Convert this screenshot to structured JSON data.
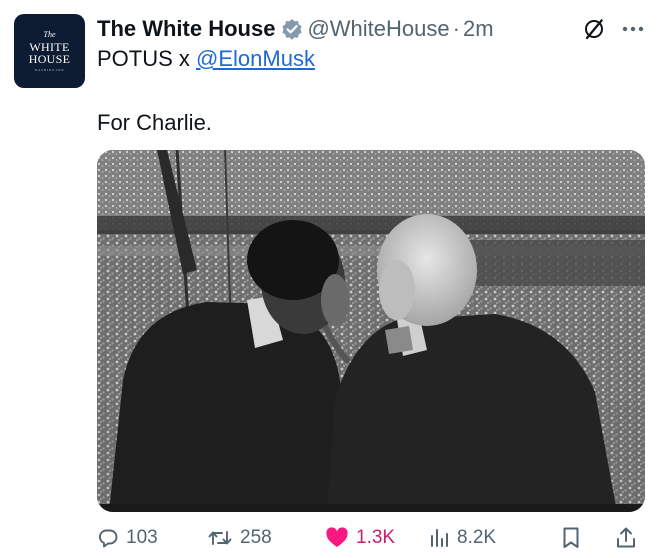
{
  "tweet": {
    "display_name": "The White House",
    "handle": "@WhiteHouse",
    "separator": "·",
    "time": "2m",
    "sub_prefix": "POTUS x",
    "mention": "@ElonMusk",
    "text": "For Charlie.",
    "avatar": {
      "the": "The",
      "line1": "WHITE",
      "line2": "HOUSE",
      "sub": "WASHINGTON"
    },
    "icons": {
      "verified": "verified-badge-icon",
      "grok": "grok-icon",
      "more": "more-icon"
    },
    "media": {
      "alt": "black-and-white photo of two men in suits seen from behind, watching a stadium crowd"
    }
  },
  "actions": {
    "replies": "103",
    "retweets": "258",
    "likes": "1.3K",
    "views": "8.2K",
    "icons": [
      "reply-icon",
      "retweet-icon",
      "like-icon",
      "views-icon",
      "bookmark-icon",
      "share-icon"
    ]
  },
  "colors": {
    "text": "#0f1419",
    "muted": "#536471",
    "link": "#1d6ad5",
    "like": "#cf1b6e",
    "avatar_bg": "#0d1b33"
  }
}
